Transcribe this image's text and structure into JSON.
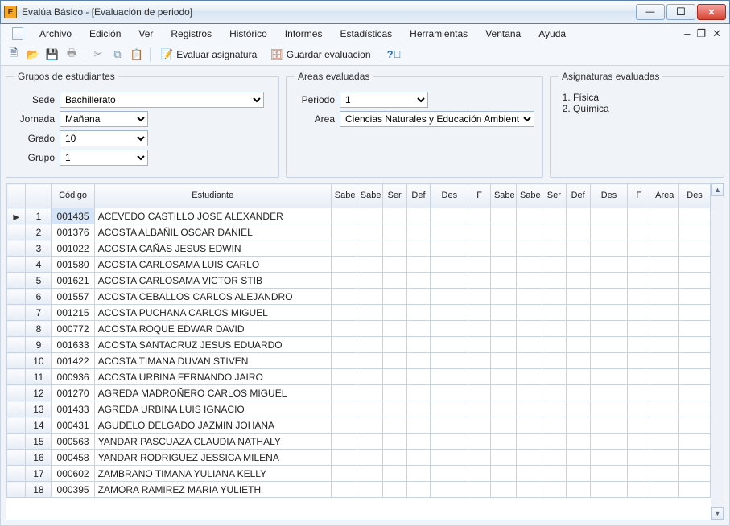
{
  "window": {
    "app_letter": "E",
    "title": "Evalúa Básico - [Evaluación de periodo]"
  },
  "menu": {
    "items": [
      "Archivo",
      "Edición",
      "Ver",
      "Registros",
      "Histórico",
      "Informes",
      "Estadísticas",
      "Herramientas",
      "Ventana",
      "Ayuda"
    ]
  },
  "toolbar": {
    "eval_asig": "Evaluar asignatura",
    "guardar": "Guardar evaluacion"
  },
  "groups": {
    "students": {
      "legend": "Grupos de estudiantes",
      "sede_label": "Sede",
      "sede_value": "Bachillerato",
      "jornada_label": "Jornada",
      "jornada_value": "Mañana",
      "grado_label": "Grado",
      "grado_value": "10",
      "grupo_label": "Grupo",
      "grupo_value": "1"
    },
    "areas": {
      "legend": "Areas evaluadas",
      "periodo_label": "Periodo",
      "periodo_value": "1",
      "area_label": "Area",
      "area_value": "Ciencias Naturales y Educación Ambiental"
    },
    "subjects": {
      "legend": "Asignaturas evaluadas",
      "items": [
        "Física",
        "Química"
      ]
    }
  },
  "grid": {
    "headers": {
      "codigo": "Código",
      "estudiante": "Estudiante",
      "saber": "Sabe",
      "saber_hacer": "Sabe hace",
      "ser": "Ser",
      "def": "Def",
      "des": "Des",
      "f": "F",
      "area": "Area"
    },
    "rows": [
      {
        "n": 1,
        "code": "001435",
        "name": "ACEVEDO CASTILLO JOSE ALEXANDER"
      },
      {
        "n": 2,
        "code": "001376",
        "name": "ACOSTA ALBAÑIL OSCAR DANIEL"
      },
      {
        "n": 3,
        "code": "001022",
        "name": "ACOSTA CAÑAS JESUS EDWIN"
      },
      {
        "n": 4,
        "code": "001580",
        "name": "ACOSTA CARLOSAMA LUIS CARLO"
      },
      {
        "n": 5,
        "code": "001621",
        "name": "ACOSTA CARLOSAMA VICTOR STIB"
      },
      {
        "n": 6,
        "code": "001557",
        "name": "ACOSTA CEBALLOS CARLOS ALEJANDRO"
      },
      {
        "n": 7,
        "code": "001215",
        "name": "ACOSTA PUCHANA CARLOS MIGUEL"
      },
      {
        "n": 8,
        "code": "000772",
        "name": "ACOSTA ROQUE EDWAR DAVID"
      },
      {
        "n": 9,
        "code": "001633",
        "name": "ACOSTA SANTACRUZ JESUS EDUARDO"
      },
      {
        "n": 10,
        "code": "001422",
        "name": "ACOSTA TIMANA DUVAN STIVEN"
      },
      {
        "n": 11,
        "code": "000936",
        "name": "ACOSTA URBINA FERNANDO JAIRO"
      },
      {
        "n": 12,
        "code": "001270",
        "name": "AGREDA MADROÑERO CARLOS MIGUEL"
      },
      {
        "n": 13,
        "code": "001433",
        "name": "AGREDA URBINA LUIS IGNACIO"
      },
      {
        "n": 14,
        "code": "000431",
        "name": "AGUDELO DELGADO JAZMIN JOHANA"
      },
      {
        "n": 15,
        "code": "000563",
        "name": "YANDAR PASCUAZA CLAUDIA NATHALY"
      },
      {
        "n": 16,
        "code": "000458",
        "name": "YANDAR RODRIGUEZ JESSICA MILENA"
      },
      {
        "n": 17,
        "code": "000602",
        "name": "ZAMBRANO TIMANA YULIANA KELLY"
      },
      {
        "n": 18,
        "code": "000395",
        "name": "ZAMORA RAMIREZ MARIA YULIETH"
      }
    ],
    "selected_row": 1
  }
}
